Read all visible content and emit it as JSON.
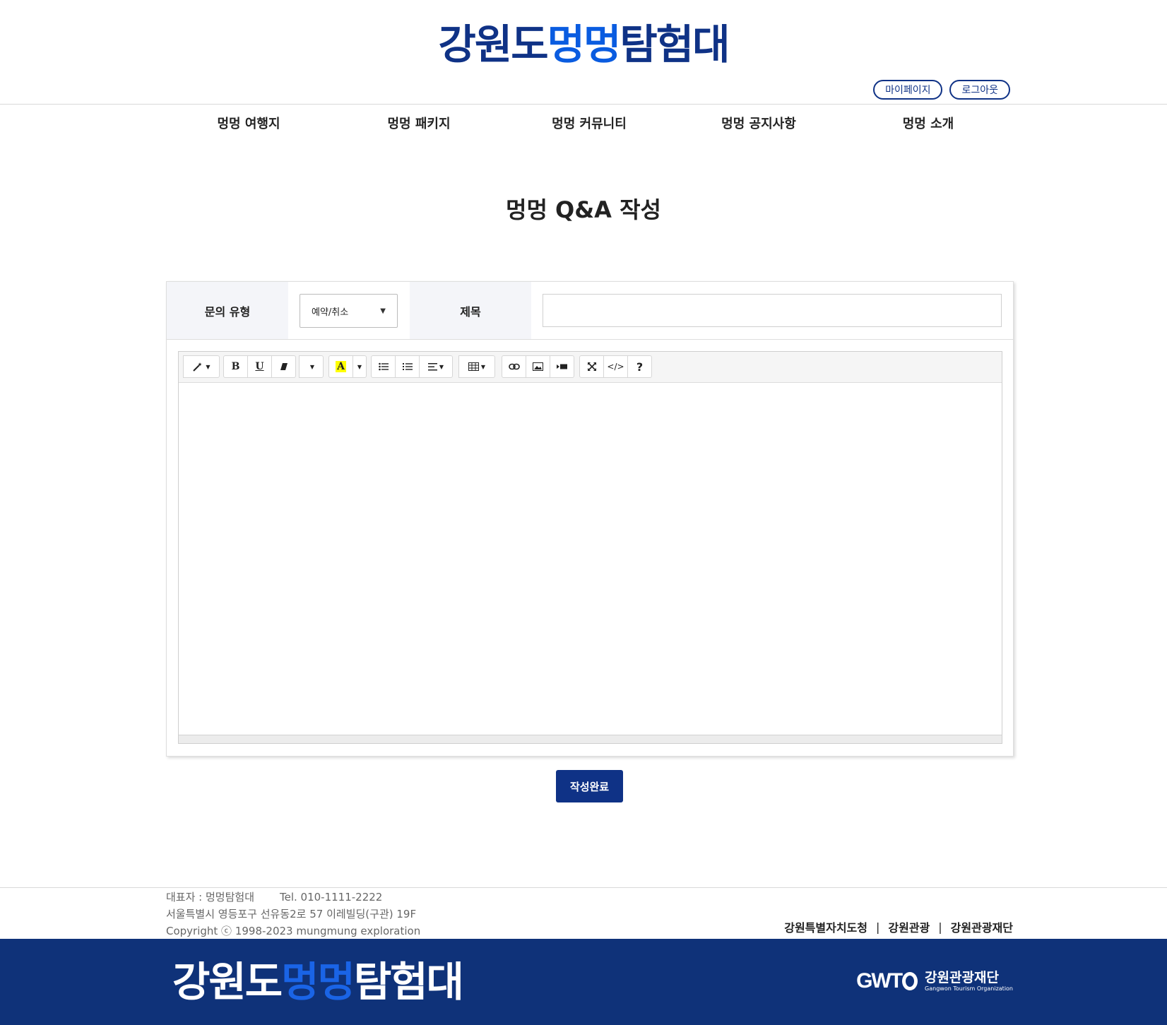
{
  "header": {
    "logo": {
      "part1": "강원도",
      "part2": "멍멍",
      "part3": "탐험대"
    },
    "auth": {
      "mypage": "마이페이지",
      "logout": "로그아웃"
    }
  },
  "nav": [
    "멍멍 여행지",
    "멍멍 패키지",
    "멍멍 커뮤니티",
    "멍멍 공지사항",
    "멍멍 소개"
  ],
  "page": {
    "title": "멍멍 Q&A 작성"
  },
  "form": {
    "type_label": "문의 유형",
    "type_selected": "예약/취소",
    "title_label": "제목",
    "title_value": ""
  },
  "toolbar": {
    "bold": "B",
    "underline": "U",
    "font_color_a": "A",
    "code": "</>",
    "help": "?"
  },
  "submit_label": "작성완료",
  "footer": {
    "representative": "대표자 : 멍멍탐험대",
    "tel": "Tel. 010-1111-2222",
    "address": "서울특별시 영등포구 선유동2로 57 이레빌딩(구관) 19F",
    "copyright": "Copyright ⓒ 1998-2023 mungmung exploration",
    "links": [
      "강원특별자치도청",
      "강원관광",
      "강원관광재단"
    ],
    "logo": {
      "part1": "강원도",
      "part2": "멍멍",
      "part3": "탐험대"
    },
    "gwto": {
      "mark": "GWT",
      "org_ko": "강원관광재단",
      "org_en": "Gangwon Tourism Organization"
    }
  },
  "colors": {
    "brand_navy": "#0f3286",
    "brand_blue": "#0a5ce0",
    "footer_band": "#0f3279",
    "label_bg": "#f4f5f9"
  }
}
